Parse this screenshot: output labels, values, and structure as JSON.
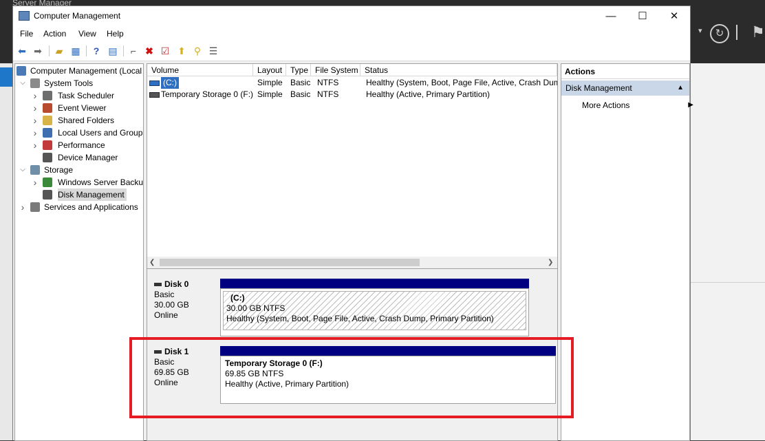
{
  "background_app": {
    "title": "Server Manager"
  },
  "window": {
    "title": "Computer Management",
    "minimize_glyph": "—",
    "maximize_glyph": "☐",
    "close_glyph": "✕"
  },
  "menu": [
    "File",
    "Action",
    "View",
    "Help"
  ],
  "toolbar_icons": [
    "back-icon",
    "forward-icon",
    "up-folder-icon",
    "show-hide-tree-icon",
    "help-icon",
    "properties-icon",
    "connect-icon",
    "delete-icon",
    "check-icon",
    "export-icon",
    "search-icon",
    "list-icon"
  ],
  "tree": [
    {
      "label": "Computer Management (Local",
      "level": 0,
      "expander": "",
      "icon": "computer-icon",
      "color": "#4a7ab5"
    },
    {
      "label": "System Tools",
      "level": 1,
      "expander": "expanded",
      "icon": "tools-icon",
      "color": "#8a8a8a"
    },
    {
      "label": "Task Scheduler",
      "level": 2,
      "expander": "collapsed",
      "icon": "clock-icon",
      "color": "#6e6e6e"
    },
    {
      "label": "Event Viewer",
      "level": 2,
      "expander": "collapsed",
      "icon": "event-viewer-icon",
      "color": "#b84a2e"
    },
    {
      "label": "Shared Folders",
      "level": 2,
      "expander": "collapsed",
      "icon": "shared-folder-icon",
      "color": "#d8b448"
    },
    {
      "label": "Local Users and Groups",
      "level": 2,
      "expander": "collapsed",
      "icon": "users-icon",
      "color": "#3f6fb0"
    },
    {
      "label": "Performance",
      "level": 2,
      "expander": "collapsed",
      "icon": "performance-icon",
      "color": "#c23a3a"
    },
    {
      "label": "Device Manager",
      "level": 2,
      "expander": "",
      "icon": "device-manager-icon",
      "color": "#555555"
    },
    {
      "label": "Storage",
      "level": 1,
      "expander": "expanded",
      "icon": "storage-icon",
      "color": "#6f8fa8"
    },
    {
      "label": "Windows Server Backup",
      "level": 2,
      "expander": "collapsed",
      "icon": "backup-icon",
      "color": "#3a8a3a"
    },
    {
      "label": "Disk Management",
      "level": 2,
      "expander": "",
      "icon": "disk-icon",
      "color": "#555555",
      "selected": true
    },
    {
      "label": "Services and Applications",
      "level": 1,
      "expander": "collapsed",
      "icon": "services-icon",
      "color": "#7a7a7a"
    }
  ],
  "columns": [
    "Volume",
    "Layout",
    "Type",
    "File System",
    "Status"
  ],
  "volumes": [
    {
      "volume": "(C:)",
      "layout": "Simple",
      "type": "Basic",
      "fs": "NTFS",
      "status": "Healthy (System, Boot, Page File, Active, Crash Dump, Primary Partition)"
    },
    {
      "volume": "Temporary Storage 0 (F:)",
      "layout": "Simple",
      "type": "Basic",
      "fs": "NTFS",
      "status": "Healthy (Active, Primary Partition)"
    }
  ],
  "disks": [
    {
      "name": "Disk 0",
      "type": "Basic",
      "size": "30.00 GB",
      "state": "Online",
      "partition": {
        "title": "(C:)",
        "size": "30.00 GB NTFS",
        "status": "Healthy (System, Boot, Page File, Active, Crash Dump, Primary Partition)"
      }
    },
    {
      "name": "Disk 1",
      "type": "Basic",
      "size": "69.85 GB",
      "state": "Online",
      "partition": {
        "title": "Temporary Storage 0  (F:)",
        "size": "69.85 GB NTFS",
        "status": "Healthy (Active, Primary Partition)"
      }
    }
  ],
  "actions": {
    "header": "Actions",
    "section": "Disk Management",
    "items": [
      "More Actions"
    ]
  },
  "colors": {
    "highlight_box": "#e51c23",
    "partition_bar": "#000080",
    "action_section": "#c9d7e8"
  }
}
